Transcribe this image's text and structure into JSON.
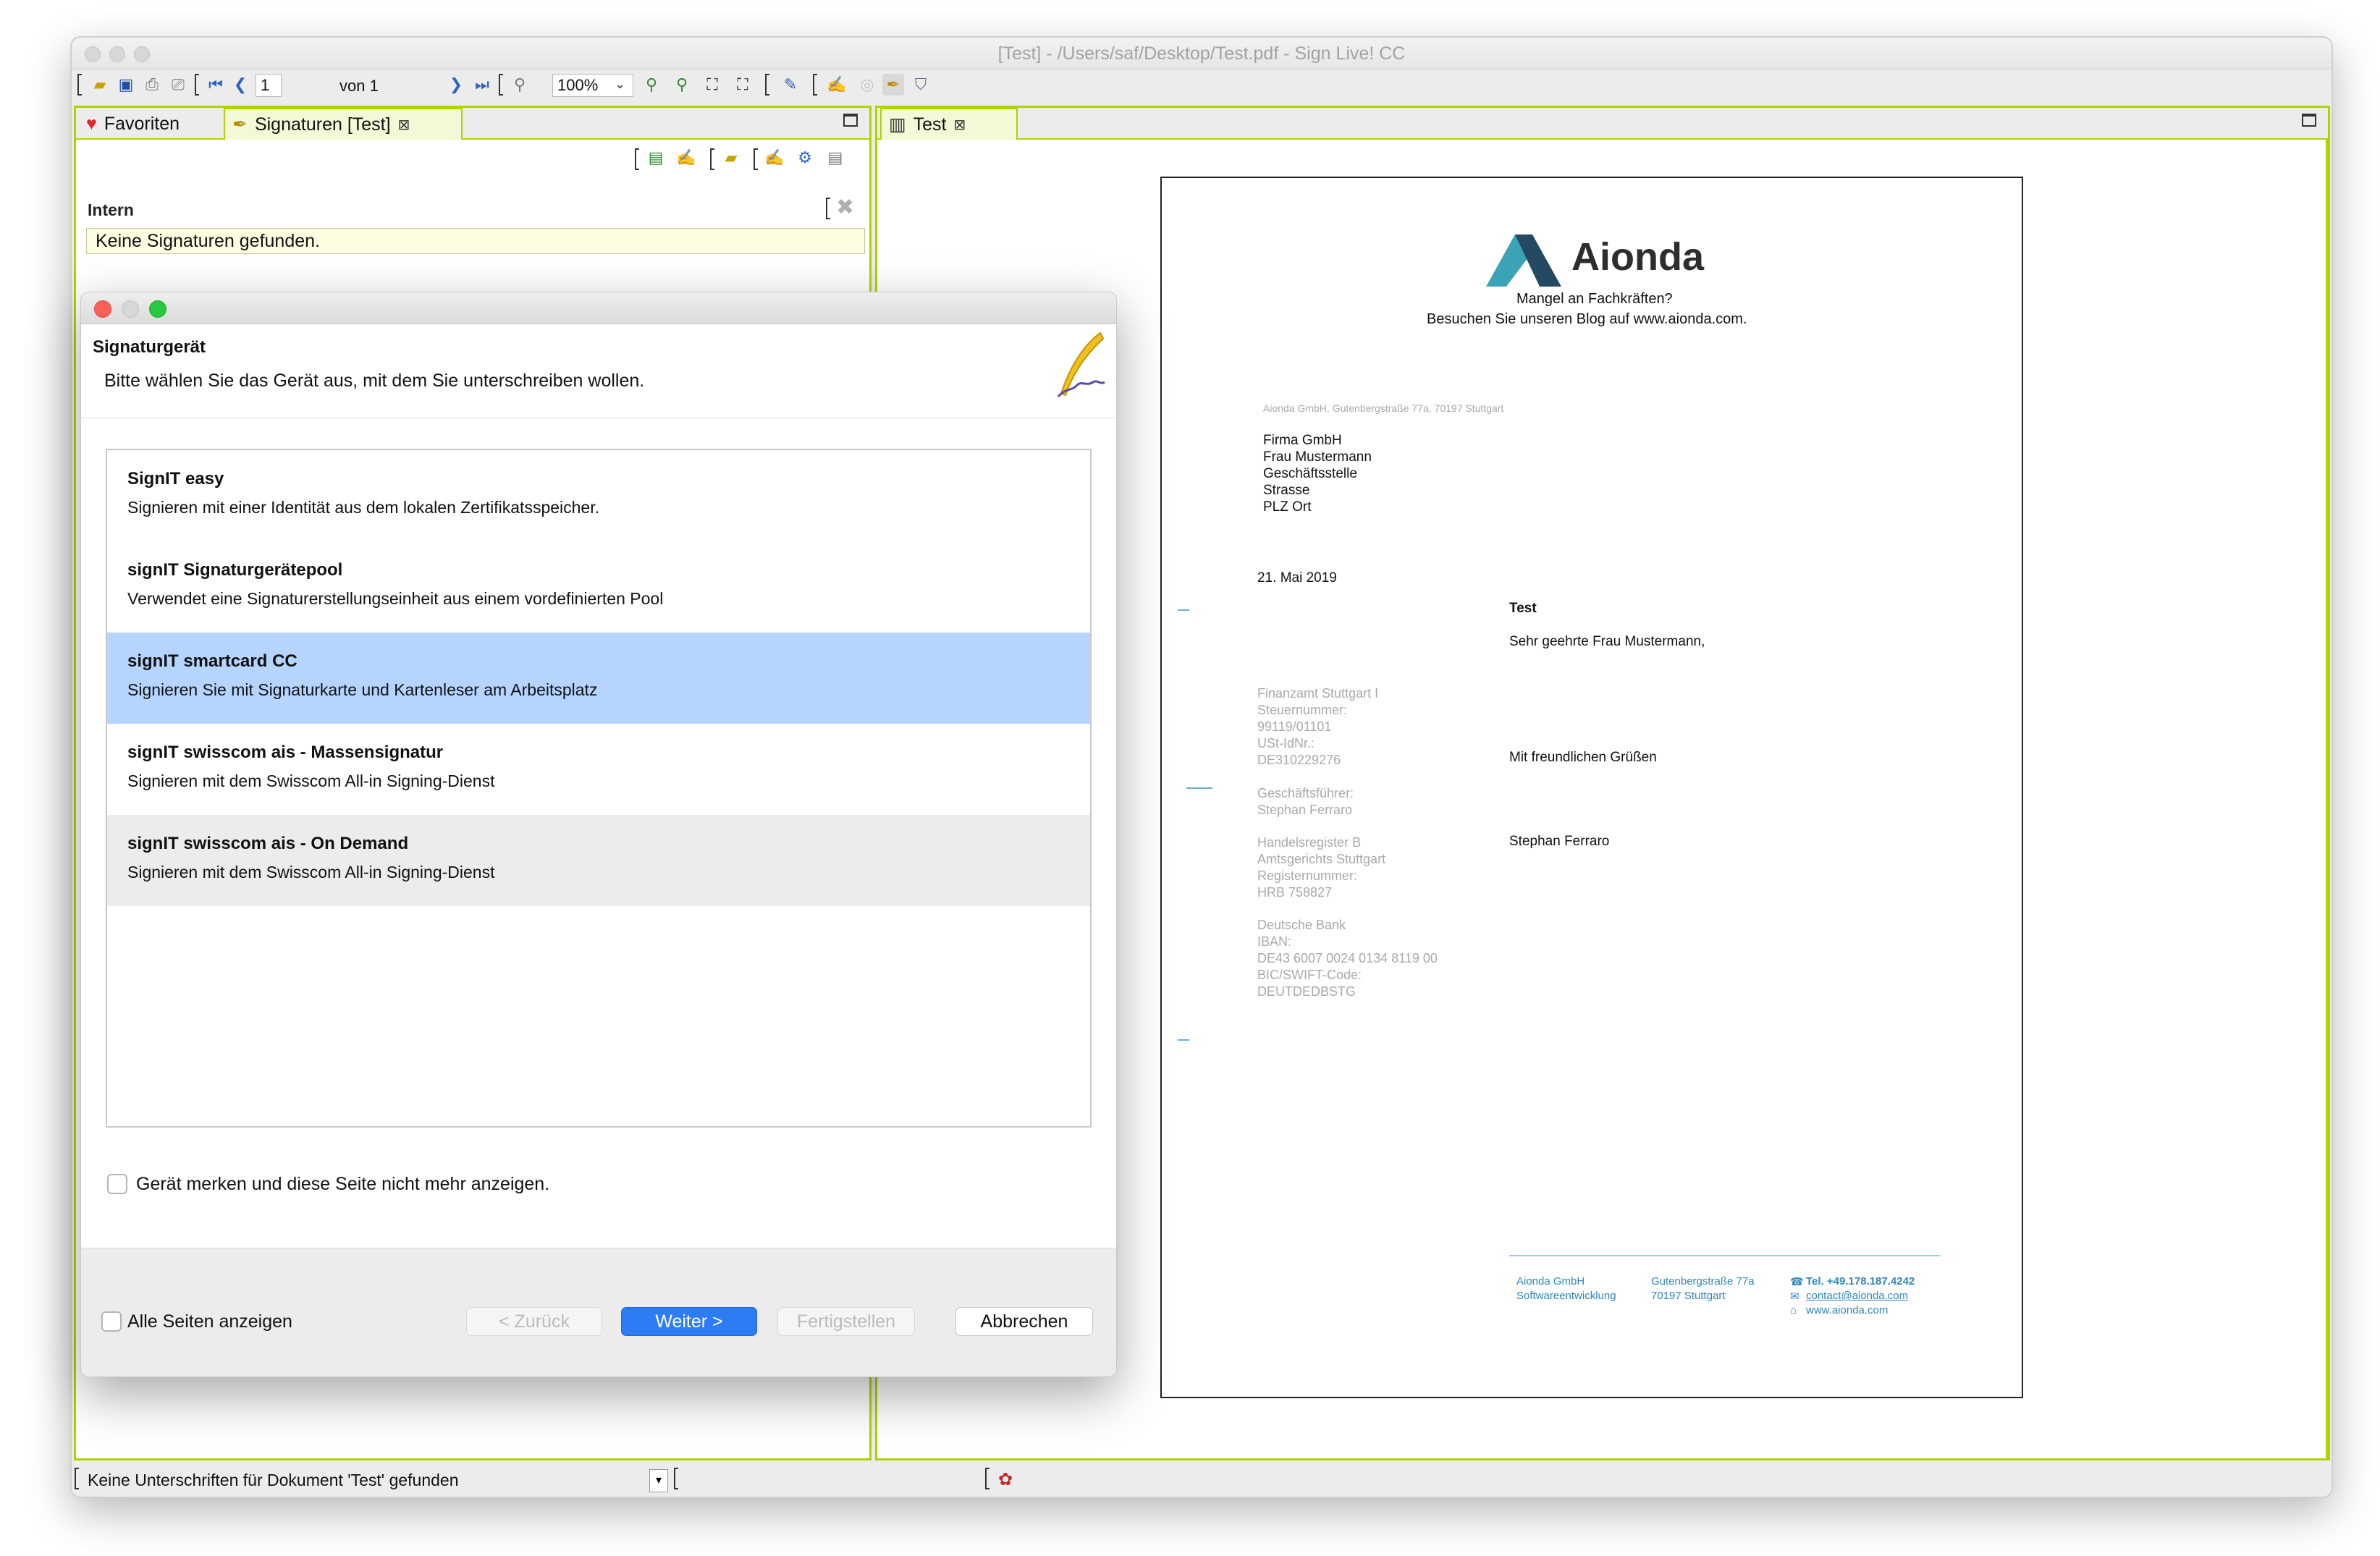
{
  "window": {
    "title": "[Test] - /Users/saf/Desktop/Test.pdf - Sign Live! CC"
  },
  "toolbar": {
    "page_number": "1",
    "page_total_label": "von 1",
    "zoom": "100%"
  },
  "left_panel": {
    "tabs": [
      {
        "label": "Favoriten"
      },
      {
        "label": "Signaturen [Test]"
      }
    ],
    "group_label": "Intern",
    "empty_message": "Keine Signaturen gefunden."
  },
  "right_panel": {
    "tab_label": "Test"
  },
  "pdf": {
    "brand": "Aionda",
    "tagline_1": "Mangel an Fachkräften?",
    "tagline_2": "Besuchen Sie unseren Blog auf www.aionda.com.",
    "sender_line": "Aionda GmbH, Gutenbergstraße 77a, 70197 Stuttgart",
    "recipient": [
      "Firma GmbH",
      "Frau Mustermann",
      "Geschäftsstelle",
      "Strasse",
      "PLZ Ort"
    ],
    "date": "21. Mai 2019",
    "subject": "Test",
    "salutation": "Sehr geehrte Frau Mustermann,",
    "closing": "Mit freundlichen Grüßen",
    "signature_name": "Stephan Ferraro",
    "sidebar": [
      "Finanzamt Stuttgart I",
      "Steuernummer:",
      "99119/01101",
      "USt-IdNr.:",
      "DE310229276",
      "Geschäftsführer:",
      "Stephan Ferraro",
      "Handelsregister B",
      "Amtsgerichts Stuttgart",
      "Registernummer:",
      "HRB 758827",
      "Deutsche Bank",
      "IBAN:",
      "DE43 6007 0024 0134 8119 00",
      "BIC/SWIFT-Code:",
      "DEUTDEDBSTG"
    ],
    "footer": {
      "col1": [
        "Aionda GmbH",
        "Softwareentwicklung"
      ],
      "col2": [
        "Gutenbergstraße 77a",
        "70197 Stuttgart"
      ],
      "phone": "Tel. +49.178.187.4242",
      "email": "contact@aionda.com",
      "web": "www.aionda.com"
    }
  },
  "status": {
    "message": "Keine Unterschriften für Dokument 'Test' gefunden"
  },
  "dialog": {
    "title": "Signaturgerät",
    "description": "Bitte wählen Sie das Gerät aus, mit dem Sie unterschreiben wollen.",
    "devices": [
      {
        "name": "SignIT easy",
        "desc": "Signieren mit einer Identität aus dem lokalen Zertifikatsspeicher."
      },
      {
        "name": "signIT Signaturgerätepool",
        "desc": "Verwendet eine Signaturerstellungseinheit aus einem vordefinierten Pool"
      },
      {
        "name": "signIT smartcard CC",
        "desc": "Signieren Sie mit Signaturkarte und Kartenleser am Arbeitsplatz"
      },
      {
        "name": "signIT swisscom ais - Massensignatur",
        "desc": "Signieren mit dem Swisscom All-in Signing-Dienst"
      },
      {
        "name": "signIT swisscom ais - On Demand",
        "desc": "Signieren mit dem Swisscom All-in Signing-Dienst"
      }
    ],
    "remember_label": "Gerät merken und diese Seite nicht mehr anzeigen.",
    "show_all_label": "Alle Seiten anzeigen",
    "buttons": {
      "back": "< Zurück",
      "next": "Weiter >",
      "finish": "Fertigstellen",
      "cancel": "Abbrechen"
    }
  },
  "colors": {
    "accent": "#aed400",
    "selection": "#b5d5ff",
    "primary_button": "#2d7cf6",
    "brand_teal": "#3aa3b5"
  },
  "icons": [
    "open-icon",
    "save-icon",
    "print-icon",
    "scan-icon",
    "first-page-icon",
    "prev-page-icon",
    "next-page-icon",
    "last-page-icon",
    "zoom-out-icon",
    "zoom-in-icon",
    "fit-icon",
    "attach-icon",
    "sign-icon",
    "heart-icon",
    "pen-icon",
    "close-icon",
    "maximize-icon",
    "feather-icon"
  ]
}
